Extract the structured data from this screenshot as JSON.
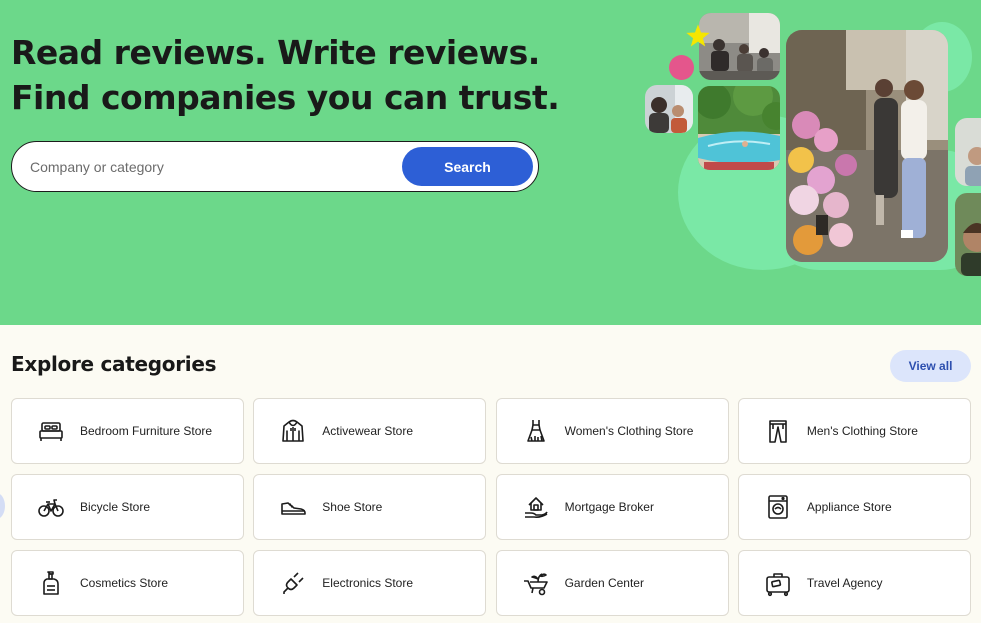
{
  "hero": {
    "headline_line1": "Read reviews. Write reviews.",
    "headline_line2": "Find companies you can trust.",
    "colors": {
      "background": "#6cd88a",
      "blob": "#7ae8a6",
      "accent_dot": "#e4568c",
      "star": "#f5e600"
    }
  },
  "search": {
    "placeholder": "Company or category",
    "value": "",
    "button_label": "Search",
    "button_color": "#2d5fd6"
  },
  "categories": {
    "title": "Explore categories",
    "view_all_label": "View all",
    "items": [
      {
        "label": "Bedroom Furniture Store",
        "icon": "bed-icon"
      },
      {
        "label": "Activewear Store",
        "icon": "hoodie-icon"
      },
      {
        "label": "Women's Clothing Store",
        "icon": "dress-icon"
      },
      {
        "label": "Men's Clothing Store",
        "icon": "trousers-icon"
      },
      {
        "label": "Bicycle Store",
        "icon": "bicycle-icon"
      },
      {
        "label": "Shoe Store",
        "icon": "sneaker-icon"
      },
      {
        "label": "Mortgage Broker",
        "icon": "house-hand-icon"
      },
      {
        "label": "Appliance Store",
        "icon": "washing-machine-icon"
      },
      {
        "label": "Cosmetics Store",
        "icon": "lotion-bottle-icon"
      },
      {
        "label": "Electronics Store",
        "icon": "plug-icon"
      },
      {
        "label": "Garden Center",
        "icon": "wheelbarrow-icon"
      },
      {
        "label": "Travel Agency",
        "icon": "suitcase-icon"
      }
    ]
  }
}
